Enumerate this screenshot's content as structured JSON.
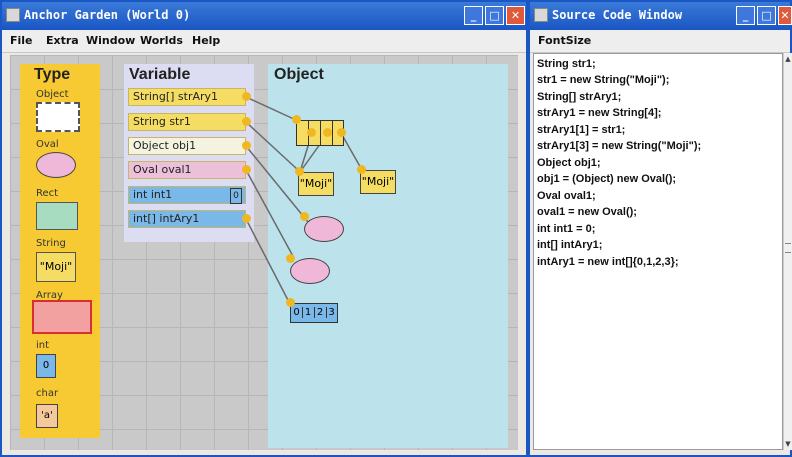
{
  "main_window": {
    "title": "Anchor Garden (World 0)",
    "menu": [
      "File",
      "Extra",
      "Window",
      "Worlds",
      "Help"
    ],
    "headers": {
      "type": "Type",
      "variable": "Variable",
      "object": "Object"
    },
    "types": {
      "object": "Object",
      "oval": "Oval",
      "rect": "Rect",
      "string": "String",
      "string_sample": "\"Moji\"",
      "array": "Array",
      "int": "int",
      "int_sample": "0",
      "char": "char",
      "char_sample": "'a'"
    },
    "variables": [
      {
        "label": "String[] strAry1",
        "color": "#f5dc63"
      },
      {
        "label": "String str1",
        "color": "#f5dc63"
      },
      {
        "label": "Object obj1",
        "color": "#f3f3e0"
      },
      {
        "label": "Oval oval1",
        "color": "#ecc0d8"
      },
      {
        "label": "int int1",
        "color": "#79b8e8",
        "value": "0"
      },
      {
        "label": "int[] intAry1",
        "color": "#79b8e8"
      }
    ],
    "objects": {
      "moji_a": "\"Moji\"",
      "moji_b": "\"Moji\"",
      "int_array": [
        "0",
        "1",
        "2",
        "3"
      ]
    }
  },
  "source_window": {
    "title": "Source Code Window",
    "menu": "FontSize",
    "lines": [
      "String str1;",
      "str1 = new String(\"Moji\");",
      "String[] strAry1;",
      "strAry1 = new String[4];",
      "strAry1[1] = str1;",
      "strAry1[3] = new String(\"Moji\");",
      "Object obj1;",
      "obj1 = (Object) new Oval();",
      "Oval oval1;",
      "oval1 = new Oval();",
      "int int1 = 0;",
      "int[] intAry1;",
      "intAry1 = new int[]{0,1,2,3};"
    ]
  }
}
